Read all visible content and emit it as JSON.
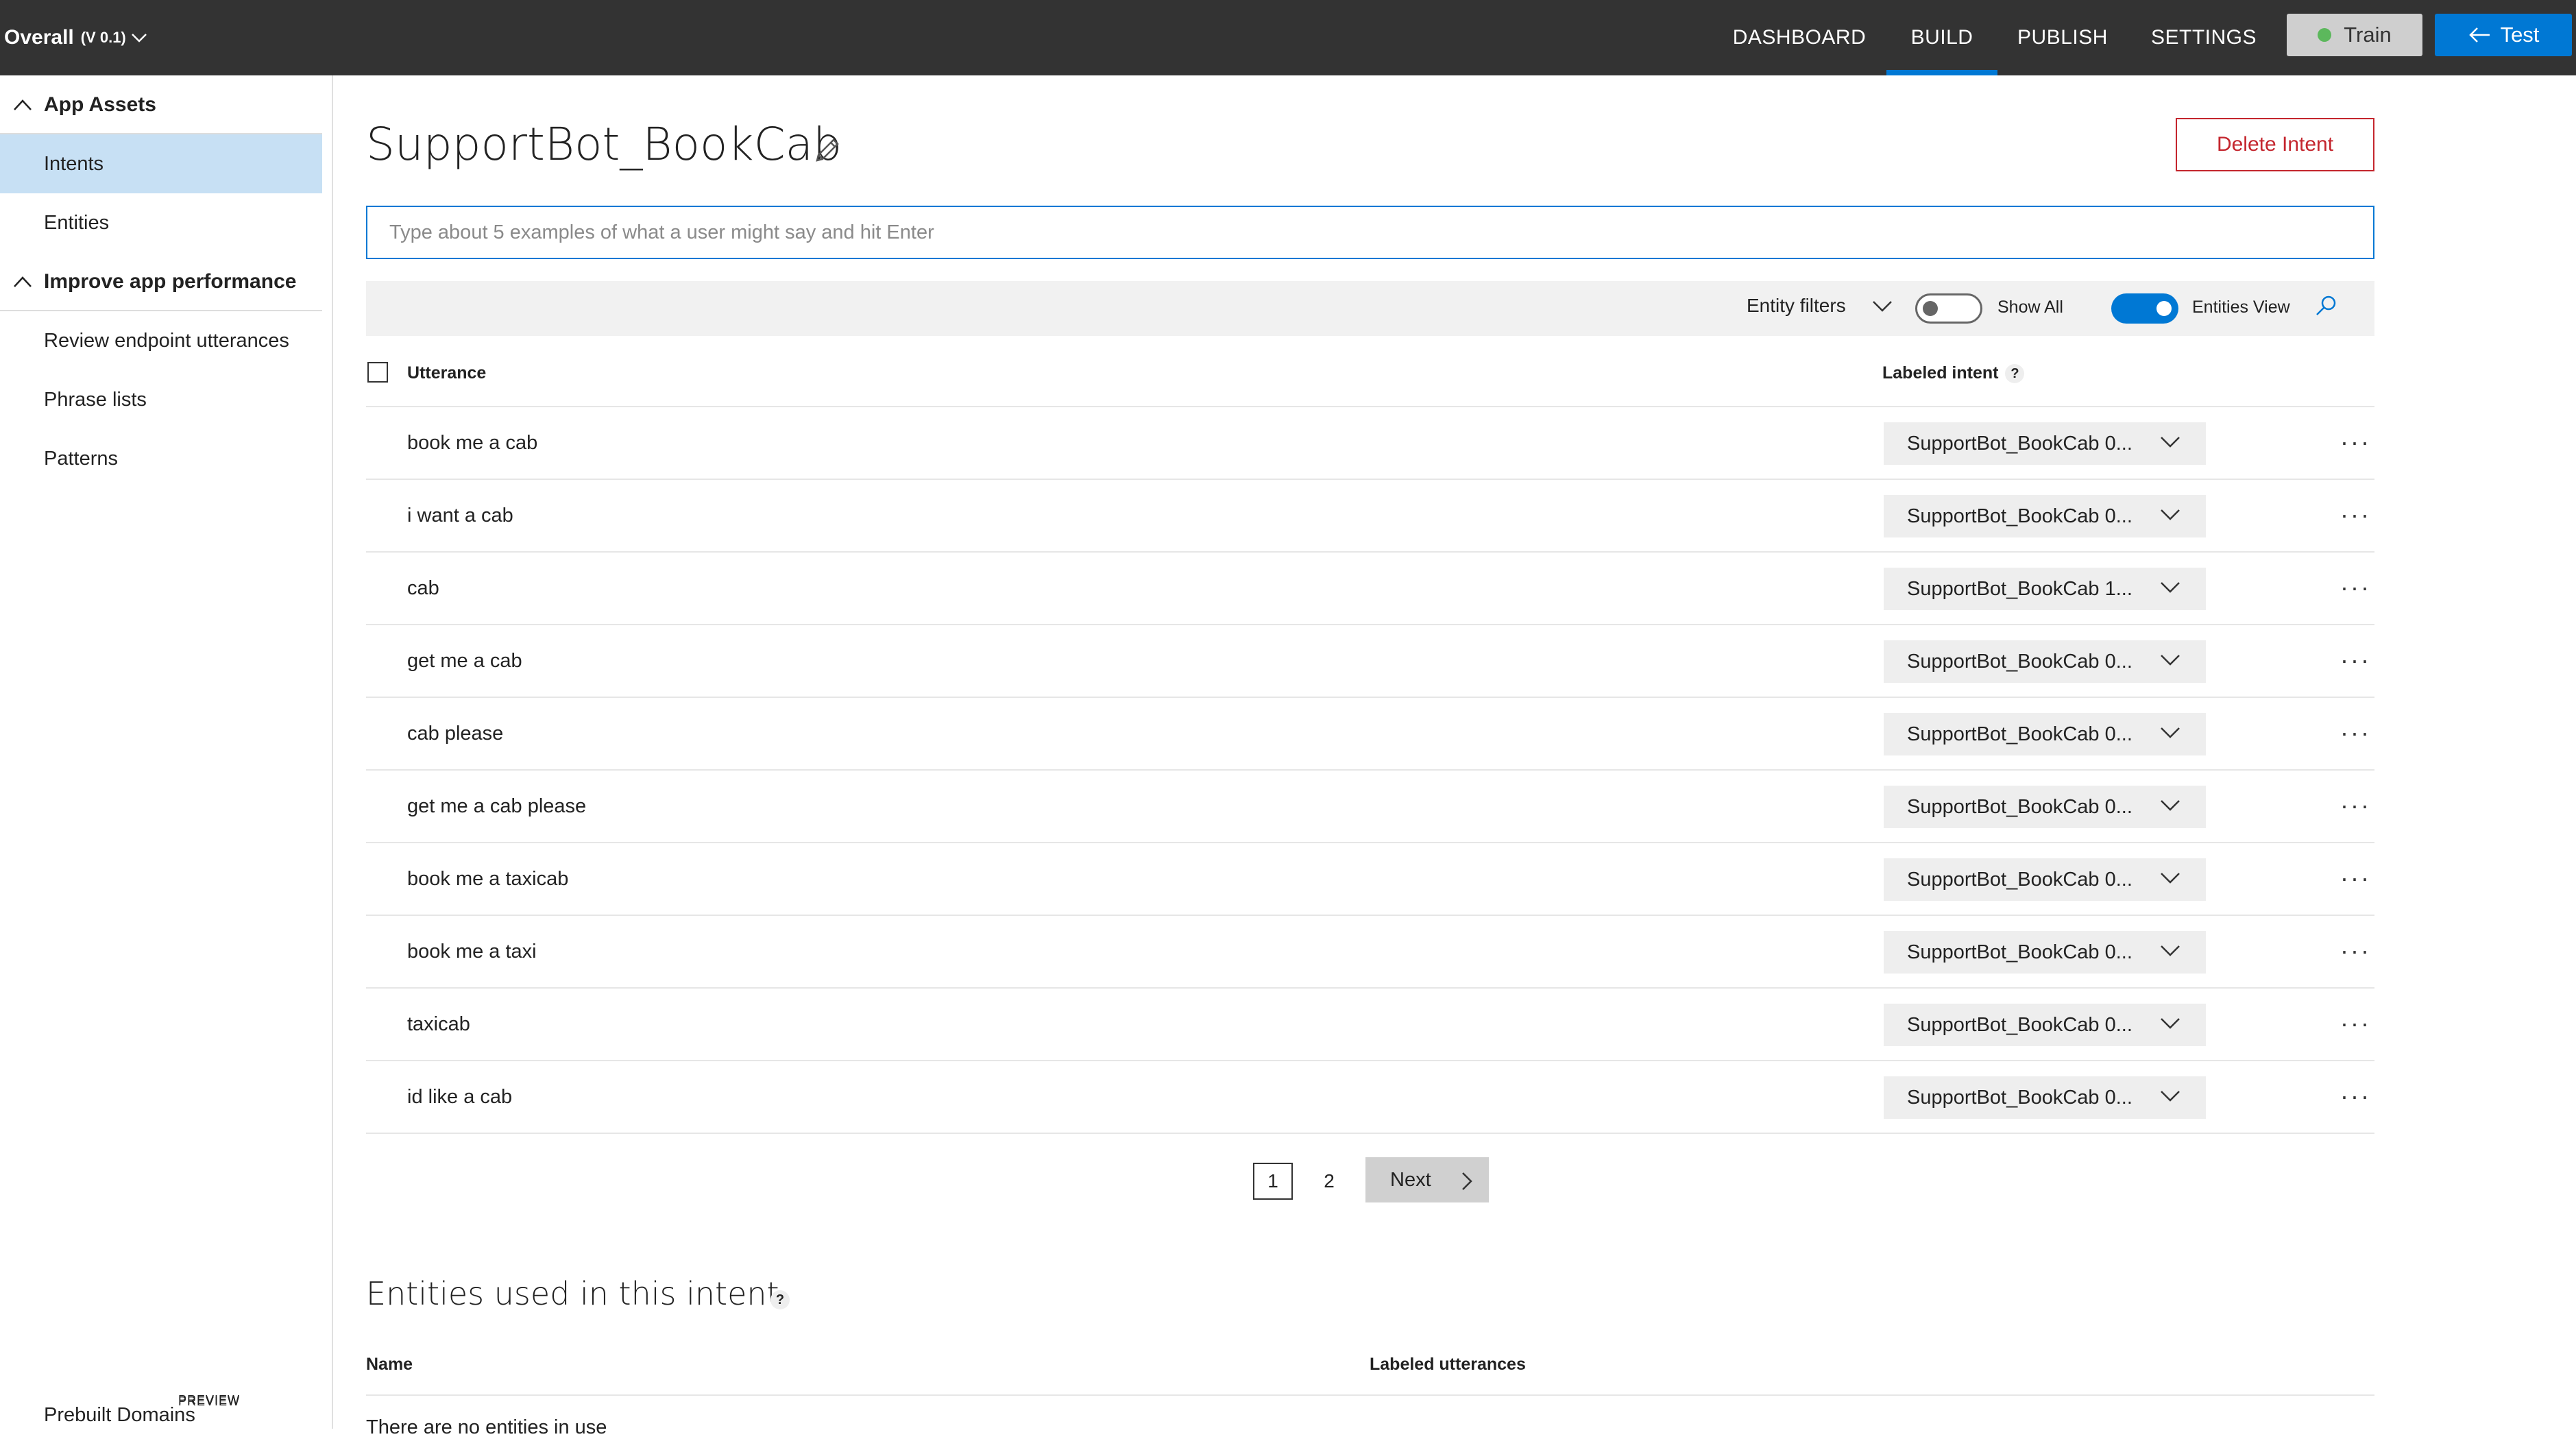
{
  "app": {
    "name": "Overall",
    "version": "(V 0.1)"
  },
  "nav": {
    "tabs": [
      "DASHBOARD",
      "BUILD",
      "PUBLISH",
      "SETTINGS"
    ],
    "active_tab": "BUILD",
    "train_label": "Train",
    "train_status_color": "#5cb85c",
    "test_label": "Test"
  },
  "sidebar": {
    "groups": [
      {
        "label": "App Assets",
        "items": [
          "Intents",
          "Entities"
        ]
      },
      {
        "label": "Improve app performance",
        "items": [
          "Review endpoint utterances",
          "Phrase lists",
          "Patterns"
        ]
      }
    ],
    "active_item": "Intents",
    "prebuilt_label": "Prebuilt Domains",
    "preview_badge": "PREVIEW"
  },
  "intent": {
    "title": "SupportBot_BookCab",
    "delete_label": "Delete Intent",
    "input_placeholder": "Type about 5 examples of what a user might say and hit Enter"
  },
  "filters": {
    "entity_filters_label": "Entity filters",
    "show_all_label": "Show All",
    "show_all_on": false,
    "entities_view_label": "Entities View",
    "entities_view_on": true
  },
  "table": {
    "col_utterance": "Utterance",
    "col_intent": "Labeled intent",
    "help": "?",
    "rows": [
      {
        "utterance": "book me a cab",
        "intent": "SupportBot_BookCab 0..."
      },
      {
        "utterance": "i want a cab",
        "intent": "SupportBot_BookCab 0..."
      },
      {
        "utterance": "cab",
        "intent": "SupportBot_BookCab 1..."
      },
      {
        "utterance": "get me a cab",
        "intent": "SupportBot_BookCab 0..."
      },
      {
        "utterance": "cab please",
        "intent": "SupportBot_BookCab 0..."
      },
      {
        "utterance": "get me a cab please",
        "intent": "SupportBot_BookCab 0..."
      },
      {
        "utterance": "book me a taxicab",
        "intent": "SupportBot_BookCab 0..."
      },
      {
        "utterance": "book me a taxi",
        "intent": "SupportBot_BookCab 0..."
      },
      {
        "utterance": "taxicab",
        "intent": "SupportBot_BookCab 0..."
      },
      {
        "utterance": "id like a cab",
        "intent": "SupportBot_BookCab 0..."
      }
    ]
  },
  "pagination": {
    "pages": [
      "1",
      "2"
    ],
    "current": "1",
    "next_label": "Next"
  },
  "entities_section": {
    "title": "Entities used in this intent",
    "col_name": "Name",
    "col_labeled": "Labeled utterances",
    "empty_text": "There are no entities in use"
  },
  "colors": {
    "topbar": "#333333",
    "accent": "#0078d4",
    "danger": "#c4262e",
    "active_bg": "#c7e0f4"
  }
}
